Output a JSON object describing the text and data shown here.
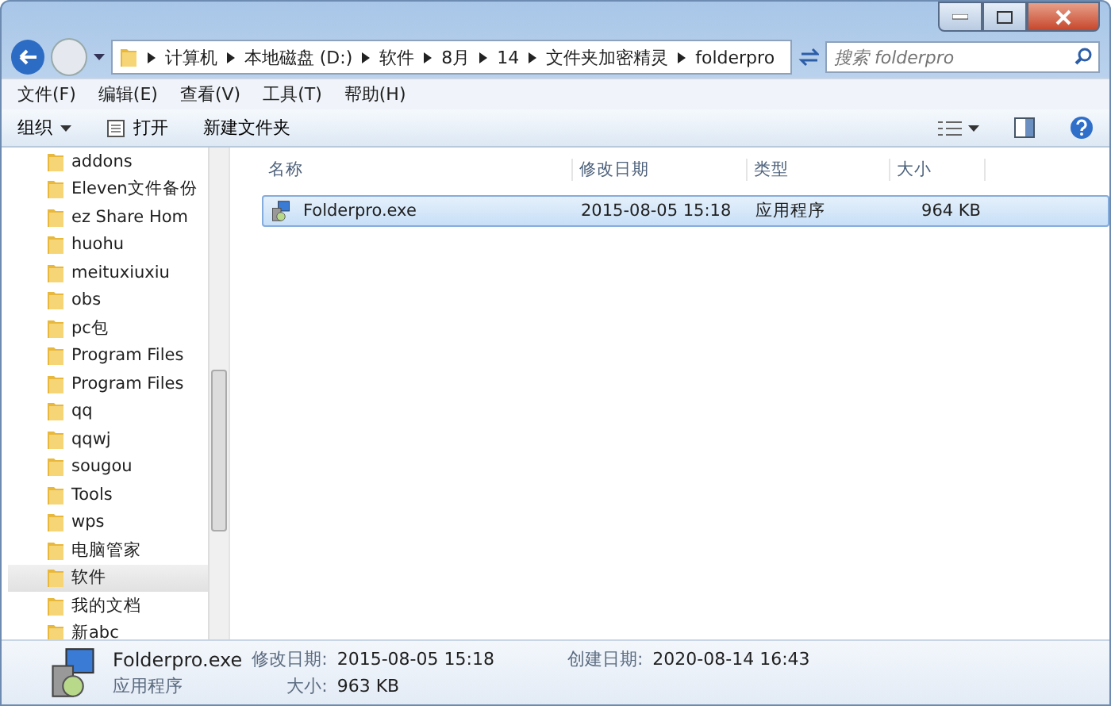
{
  "address": {
    "crumbs": [
      "计算机",
      "本地磁盘 (D:)",
      "软件",
      "8月",
      "14",
      "文件夹加密精灵",
      "folderpro"
    ]
  },
  "search": {
    "placeholder": "搜索 folderpro"
  },
  "menu": [
    "文件(F)",
    "编辑(E)",
    "查看(V)",
    "工具(T)",
    "帮助(H)"
  ],
  "toolbar": {
    "organize": "组织",
    "open": "打开",
    "new_folder": "新建文件夹"
  },
  "sidebar": {
    "items": [
      {
        "label": "addons",
        "selected": false
      },
      {
        "label": "Eleven文件备份",
        "selected": false
      },
      {
        "label": "ez Share Hom",
        "selected": false
      },
      {
        "label": "huohu",
        "selected": false
      },
      {
        "label": "meituxiuxiu",
        "selected": false
      },
      {
        "label": "obs",
        "selected": false
      },
      {
        "label": "pc包",
        "selected": false
      },
      {
        "label": "Program Files",
        "selected": false
      },
      {
        "label": "Program Files",
        "selected": false
      },
      {
        "label": "qq",
        "selected": false
      },
      {
        "label": "qqwj",
        "selected": false
      },
      {
        "label": "sougou",
        "selected": false
      },
      {
        "label": "Tools",
        "selected": false
      },
      {
        "label": "wps",
        "selected": false
      },
      {
        "label": "电脑管家",
        "selected": false
      },
      {
        "label": "软件",
        "selected": true
      },
      {
        "label": "我的文档",
        "selected": false
      },
      {
        "label": "新abc",
        "selected": false
      }
    ]
  },
  "table": {
    "columns": [
      "名称",
      "修改日期",
      "类型",
      "大小"
    ],
    "rows": [
      {
        "name": "Folderpro.exe",
        "modified": "2015-08-05 15:18",
        "type": "应用程序",
        "size": "964 KB",
        "selected": true
      }
    ]
  },
  "details": {
    "name": "Folderpro.exe",
    "modified_label": "修改日期:",
    "modified": "2015-08-05 15:18",
    "created_label": "创建日期:",
    "created": "2020-08-14 16:43",
    "type": "应用程序",
    "size_label": "大小:",
    "size": "963 KB"
  }
}
